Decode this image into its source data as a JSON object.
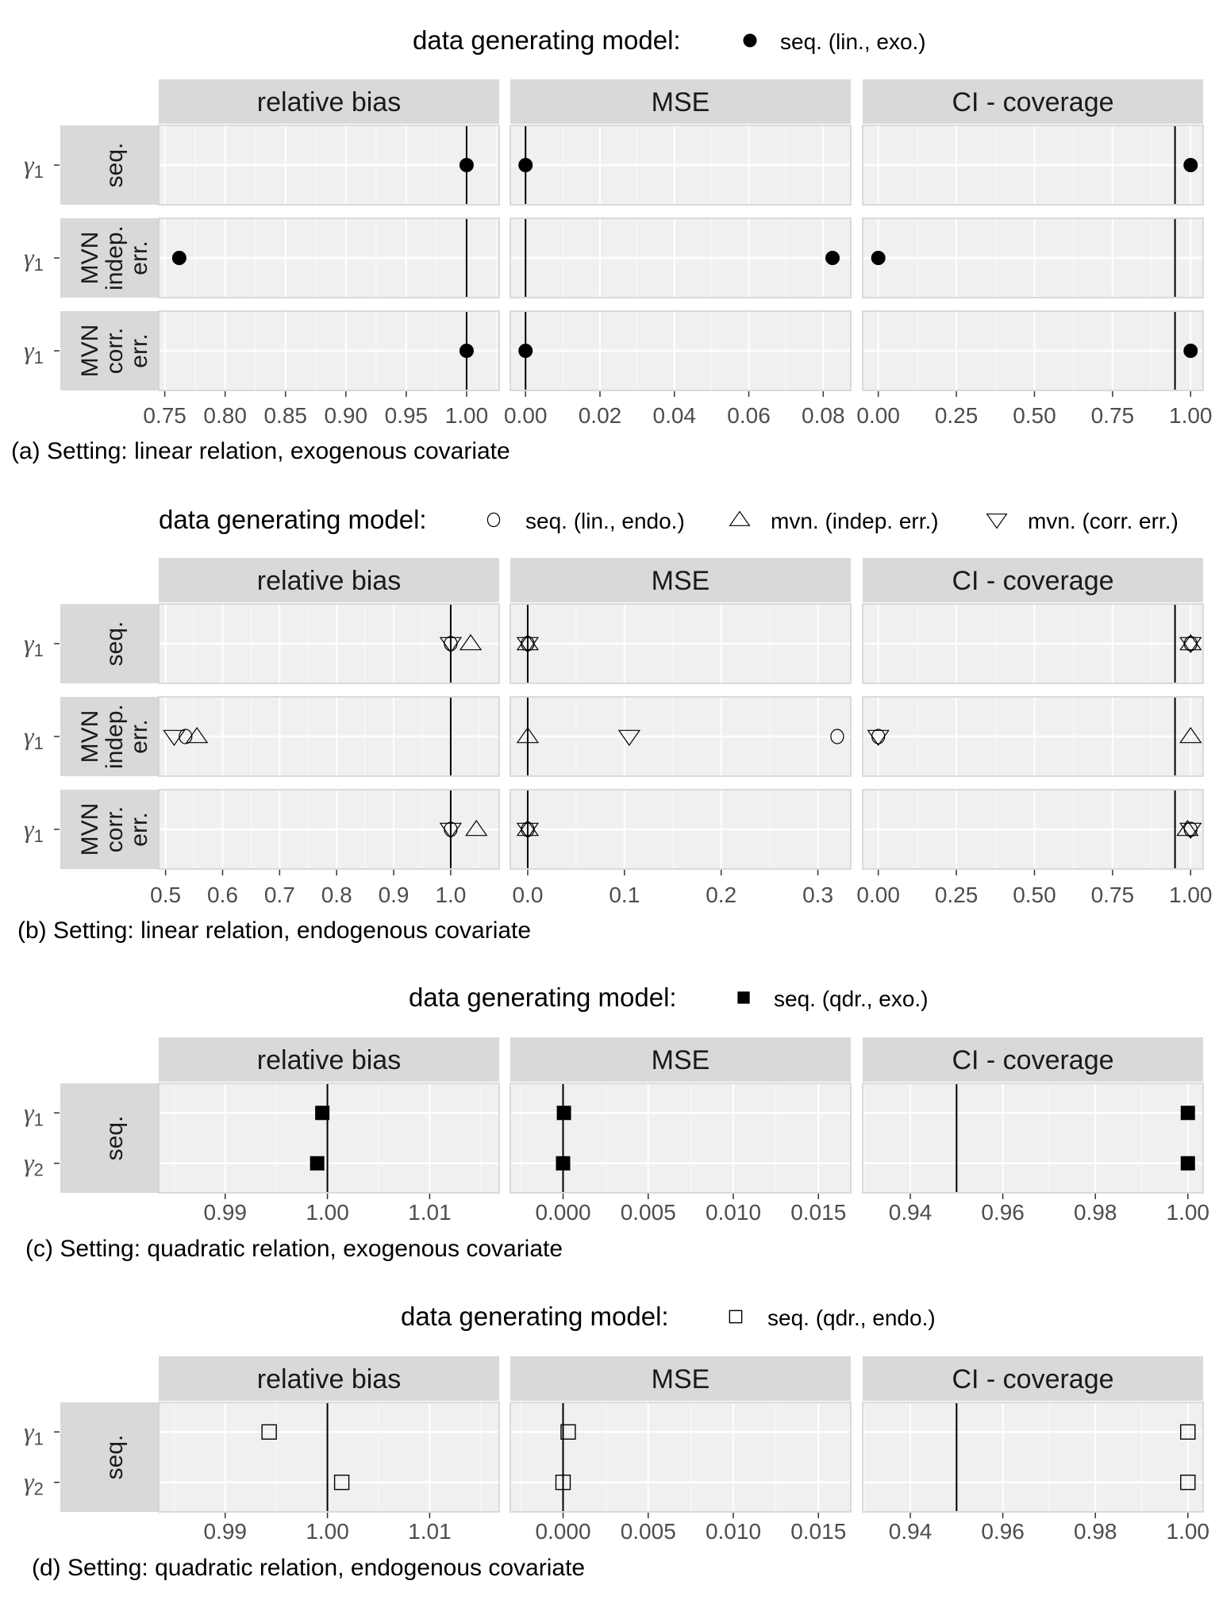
{
  "chart_data": [
    {
      "type": "scatter",
      "id": "a",
      "caption": "(a) Setting: linear relation, exogenous covariate",
      "legend": {
        "title": "data generating model:",
        "placement": "top",
        "entries": [
          {
            "label": "seq. (lin., exo.)",
            "shape": "filled-circle"
          }
        ]
      },
      "columns": [
        "relative bias",
        "MSE",
        "CI - coverage"
      ],
      "rows": [
        {
          "strip": [
            "seq."
          ],
          "ylabels": [
            "γ1"
          ]
        },
        {
          "strip": [
            "MVN",
            "indep.",
            "err."
          ],
          "ylabels": [
            "γ1"
          ]
        },
        {
          "strip": [
            "MVN",
            "corr.",
            "err."
          ],
          "ylabels": [
            "γ1"
          ]
        }
      ],
      "axes": [
        {
          "xlim": [
            0.745,
            1.027
          ],
          "ticks": [
            0.75,
            0.8,
            0.85,
            0.9,
            0.95,
            1.0
          ],
          "tick_labels": [
            "0.75",
            "0.80",
            "0.85",
            "0.90",
            "0.95",
            "1.00"
          ],
          "reference": 1.0
        },
        {
          "xlim": [
            -0.0041,
            0.0874
          ],
          "ticks": [
            0.0,
            0.02,
            0.04,
            0.06,
            0.08
          ],
          "tick_labels": [
            "0.00",
            "0.02",
            "0.04",
            "0.06",
            "0.08"
          ],
          "reference": 0.0
        },
        {
          "xlim": [
            -0.05,
            1.04
          ],
          "ticks": [
            0.0,
            0.25,
            0.5,
            0.75,
            1.0
          ],
          "tick_labels": [
            "0.00",
            "0.25",
            "0.50",
            "0.75",
            "1.00"
          ],
          "reference": 0.95
        }
      ],
      "series": [
        {
          "name": "seq. (lin., exo.)",
          "shape": "filled-circle",
          "values": [
            [
              [
                1.0
              ],
              [
                0.0
              ],
              [
                1.0
              ]
            ],
            [
              [
                0.762
              ],
              [
                0.0825
              ],
              [
                0.0
              ]
            ],
            [
              [
                1.0
              ],
              [
                0.0
              ],
              [
                1.0
              ]
            ]
          ]
        }
      ]
    },
    {
      "type": "scatter",
      "id": "b",
      "caption": "(b) Setting: linear relation, endogenous covariate",
      "legend": {
        "title": "data generating model:",
        "placement": "top",
        "entries": [
          {
            "label": "seq. (lin., endo.)",
            "shape": "open-circle"
          },
          {
            "label": "mvn. (indep. err.)",
            "shape": "open-triangle-up"
          },
          {
            "label": "mvn. (corr. err.)",
            "shape": "open-triangle-down"
          }
        ]
      },
      "columns": [
        "relative bias",
        "MSE",
        "CI - coverage"
      ],
      "rows": [
        {
          "strip": [
            "seq."
          ],
          "ylabels": [
            "γ1"
          ]
        },
        {
          "strip": [
            "MVN",
            "indep.",
            "err."
          ],
          "ylabels": [
            "γ1"
          ]
        },
        {
          "strip": [
            "MVN",
            "corr.",
            "err."
          ],
          "ylabels": [
            "γ1"
          ]
        }
      ],
      "axes": [
        {
          "xlim": [
            0.488,
            1.085
          ],
          "ticks": [
            0.5,
            0.6,
            0.7,
            0.8,
            0.9,
            1.0
          ],
          "tick_labels": [
            "0.5",
            "0.6",
            "0.7",
            "0.8",
            "0.9",
            "1.0"
          ],
          "reference": 1.0
        },
        {
          "xlim": [
            -0.018,
            0.334
          ],
          "ticks": [
            0.0,
            0.1,
            0.2,
            0.3
          ],
          "tick_labels": [
            "0.0",
            "0.1",
            "0.2",
            "0.3"
          ],
          "reference": 0.0
        },
        {
          "xlim": [
            -0.05,
            1.04
          ],
          "ticks": [
            0.0,
            0.25,
            0.5,
            0.75,
            1.0
          ],
          "tick_labels": [
            "0.00",
            "0.25",
            "0.50",
            "0.75",
            "1.00"
          ],
          "reference": 0.95
        }
      ],
      "series": [
        {
          "name": "seq. (lin., endo.)",
          "shape": "open-circle",
          "values": [
            [
              [
                1.0
              ],
              [
                0.0
              ],
              [
                1.0
              ]
            ],
            [
              [
                0.535
              ],
              [
                0.32
              ],
              [
                0.0
              ]
            ],
            [
              [
                1.0
              ],
              [
                0.0
              ],
              [
                1.0
              ]
            ]
          ]
        },
        {
          "name": "mvn. (indep. err.)",
          "shape": "open-triangle-up",
          "values": [
            [
              [
                1.035
              ],
              [
                0.0
              ],
              [
                1.0
              ]
            ],
            [
              [
                0.555
              ],
              [
                0.0
              ],
              [
                1.0
              ]
            ],
            [
              [
                1.045
              ],
              [
                0.0
              ],
              [
                0.99
              ]
            ]
          ]
        },
        {
          "name": "mvn. (corr. err.)",
          "shape": "open-triangle-down",
          "values": [
            [
              [
                1.0
              ],
              [
                0.0
              ],
              [
                1.0
              ]
            ],
            [
              [
                0.515
              ],
              [
                0.105
              ],
              [
                0.0
              ]
            ],
            [
              [
                1.0
              ],
              [
                0.0
              ],
              [
                1.0
              ]
            ]
          ]
        }
      ]
    },
    {
      "type": "scatter",
      "id": "c",
      "caption": "(c) Setting: quadratic relation, exogenous covariate",
      "legend": {
        "title": "data generating model:",
        "placement": "top",
        "entries": [
          {
            "label": "seq. (qdr., exo.)",
            "shape": "filled-square"
          }
        ]
      },
      "columns": [
        "relative bias",
        "MSE",
        "CI - coverage"
      ],
      "rows": [
        {
          "strip": [
            "seq."
          ],
          "ylabels": [
            "γ1",
            "γ2"
          ]
        }
      ],
      "axes": [
        {
          "xlim": [
            0.9835,
            1.0168
          ],
          "ticks": [
            0.99,
            1.0,
            1.01
          ],
          "tick_labels": [
            "0.99",
            "1.00",
            "1.01"
          ],
          "reference": 1.0
        },
        {
          "xlim": [
            -0.0031,
            0.0169
          ],
          "ticks": [
            0.0,
            0.005,
            0.01,
            0.015
          ],
          "tick_labels": [
            "0.000",
            "0.005",
            "0.010",
            "0.015"
          ],
          "reference": 0.0
        },
        {
          "xlim": [
            0.9297,
            1.0033
          ],
          "ticks": [
            0.94,
            0.96,
            0.98,
            1.0
          ],
          "tick_labels": [
            "0.94",
            "0.96",
            "0.98",
            "1.00"
          ],
          "reference": 0.95
        }
      ],
      "series": [
        {
          "name": "seq. (qdr., exo.)",
          "shape": "filled-square",
          "values": [
            [
              [
                0.9995,
                0.999
              ],
              [
                5e-05,
                0.0
              ],
              [
                1.0,
                1.0
              ]
            ]
          ]
        }
      ]
    },
    {
      "type": "scatter",
      "id": "d",
      "caption": "(d) Setting: quadratic relation, endogenous covariate",
      "legend": {
        "title": "data generating model:",
        "placement": "top",
        "entries": [
          {
            "label": "seq. (qdr., endo.)",
            "shape": "open-square"
          }
        ]
      },
      "columns": [
        "relative bias",
        "MSE",
        "CI - coverage"
      ],
      "rows": [
        {
          "strip": [
            "seq."
          ],
          "ylabels": [
            "γ1",
            "γ2"
          ]
        }
      ],
      "axes": [
        {
          "xlim": [
            0.9835,
            1.0168
          ],
          "ticks": [
            0.99,
            1.0,
            1.01
          ],
          "tick_labels": [
            "0.99",
            "1.00",
            "1.01"
          ],
          "reference": 1.0
        },
        {
          "xlim": [
            -0.0031,
            0.0169
          ],
          "ticks": [
            0.0,
            0.005,
            0.01,
            0.015
          ],
          "tick_labels": [
            "0.000",
            "0.005",
            "0.010",
            "0.015"
          ],
          "reference": 0.0
        },
        {
          "xlim": [
            0.9297,
            1.0033
          ],
          "ticks": [
            0.94,
            0.96,
            0.98,
            1.0
          ],
          "tick_labels": [
            "0.94",
            "0.96",
            "0.98",
            "1.00"
          ],
          "reference": 0.95
        }
      ],
      "series": [
        {
          "name": "seq. (qdr., endo.)",
          "shape": "open-square",
          "values": [
            [
              [
                0.9943,
                1.0014
              ],
              [
                0.0003,
                0.0
              ],
              [
                1.0,
                1.0
              ]
            ]
          ]
        }
      ]
    }
  ]
}
